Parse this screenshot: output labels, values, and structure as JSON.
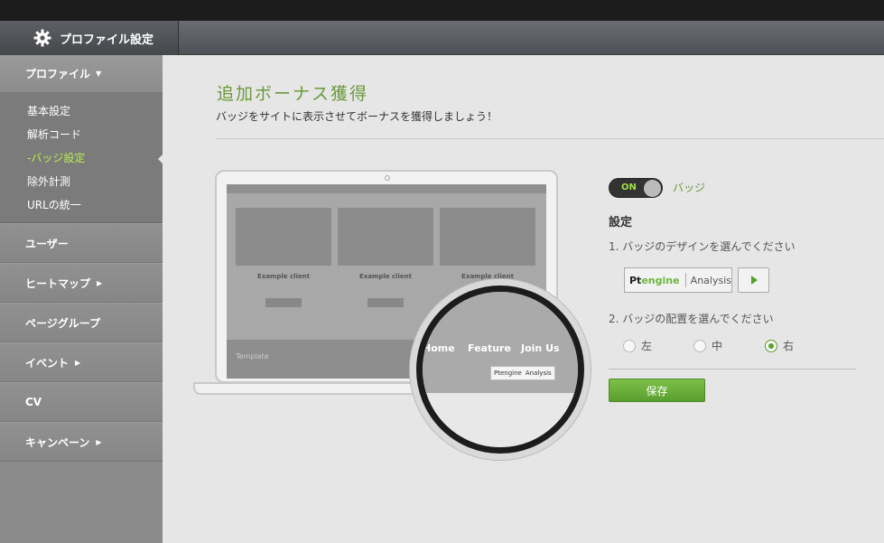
{
  "header": {
    "section_title": "プロファイル設定",
    "icon": "gear-icon"
  },
  "sidebar": {
    "profile_label": "プロファイル",
    "sub_items": [
      {
        "label": "基本設定",
        "active": false
      },
      {
        "label": "解析コード",
        "active": false
      },
      {
        "label": "-バッジ設定",
        "active": true
      },
      {
        "label": "除外計測",
        "active": false
      },
      {
        "label": "URLの統一",
        "active": false
      }
    ],
    "items": [
      {
        "label": "ユーザー",
        "arrow": false
      },
      {
        "label": "ヒートマップ",
        "arrow": true
      },
      {
        "label": "ページグループ",
        "arrow": false
      },
      {
        "label": "イベント",
        "arrow": true
      },
      {
        "label": "CV",
        "arrow": false
      },
      {
        "label": "キャンペーン",
        "arrow": true
      }
    ]
  },
  "main": {
    "title": "追加ボーナス獲得",
    "subtitle": "バッジをサイトに表示させてボーナスを獲得しましょう！",
    "illustration": {
      "clients": [
        "Example client",
        "Example client",
        "Example client"
      ],
      "template_label": "Template",
      "lens_nav": [
        "Home",
        "Feature",
        "Join Us"
      ],
      "badge_brand": "Ptengine",
      "badge_text": "Analysis"
    },
    "settings": {
      "toggle_state": "ON",
      "toggle_label": "バッジ",
      "heading": "設定",
      "step1": "1. バッジのデザインを選んでください",
      "badge_brand_pt": "Pt",
      "badge_brand_engine": "engine",
      "badge_text": "Analysis",
      "step2": "2. バッジの配置を選んでください",
      "positions": [
        {
          "label": "左",
          "selected": false
        },
        {
          "label": "中",
          "selected": false
        },
        {
          "label": "右",
          "selected": true
        }
      ],
      "save_label": "保存"
    }
  },
  "colors": {
    "accent": "#6a9a3a",
    "button_green": "#5a9f2e",
    "active_nav": "#b9f04a"
  }
}
